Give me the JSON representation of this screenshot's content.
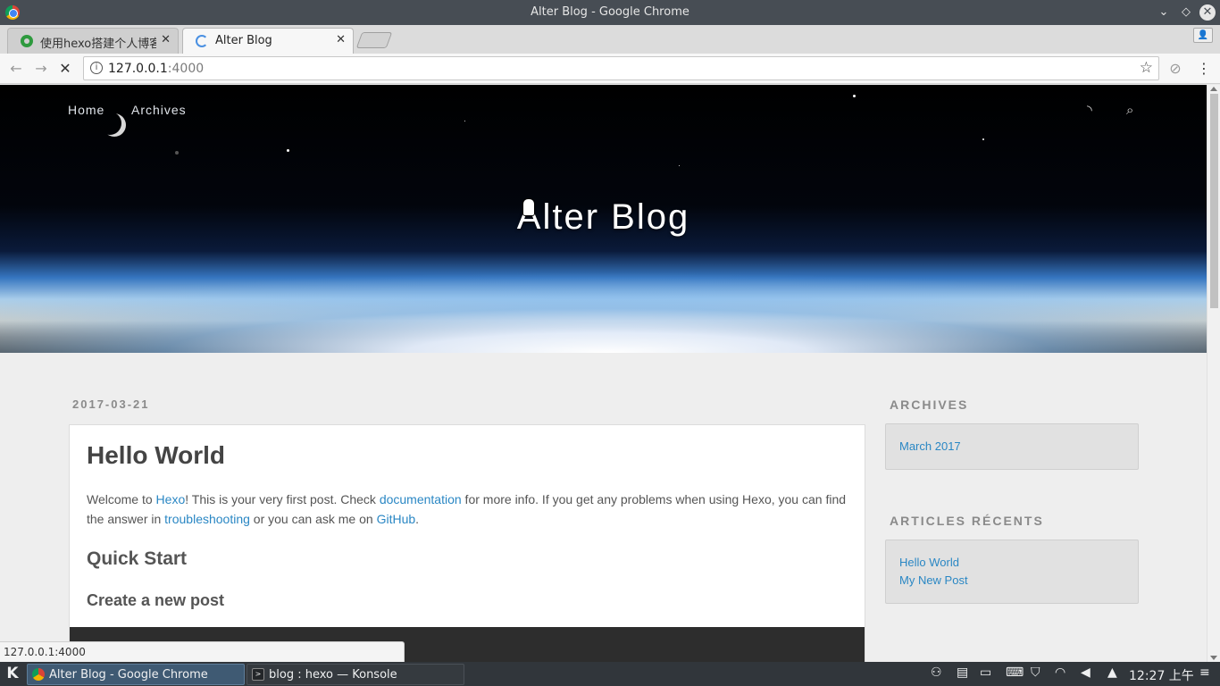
{
  "window": {
    "title": "Alter Blog - Google Chrome"
  },
  "tabs": [
    {
      "label": "使用hexo搭建个人博客",
      "favicon": "hexo-icon"
    },
    {
      "label": "Alter Blog",
      "favicon": "loading-spinner-icon"
    }
  ],
  "toolbar": {
    "url_host": "127.0.0.1",
    "url_port": ":4000"
  },
  "blog": {
    "nav": [
      "Home",
      "Archives"
    ],
    "title": "Alter Blog"
  },
  "post": {
    "date": "2017-03-21",
    "title": "Hello World",
    "p_before_hexo": "Welcome to ",
    "link_hexo": "Hexo",
    "p_after_hexo": "! This is your very first post. Check ",
    "link_docs": "documentation",
    "p_after_docs": " for more info. If you get any problems when using Hexo, you can find the answer in ",
    "link_troubleshooting": "troubleshooting",
    "p_after_troubleshooting": " or you can ask me on ",
    "link_github": "GitHub",
    "p_end": ".",
    "h2": "Quick Start",
    "h3": "Create a new post"
  },
  "sidebar": {
    "archives_title": "ARCHIVES",
    "archives_items": [
      "March 2017"
    ],
    "recent_title": "ARTICLES RÉCENTS",
    "recent_items": [
      "Hello World",
      "My New Post"
    ]
  },
  "status_url": "127.0.0.1:4000",
  "taskbar": {
    "tasks": [
      "Alter Blog - Google Chrome",
      "blog : hexo — Konsole"
    ],
    "clock": "12:27 上午"
  },
  "colors": {
    "link": "#2a87c4",
    "taskbar": "#31363b",
    "titlebar": "#474d54"
  }
}
